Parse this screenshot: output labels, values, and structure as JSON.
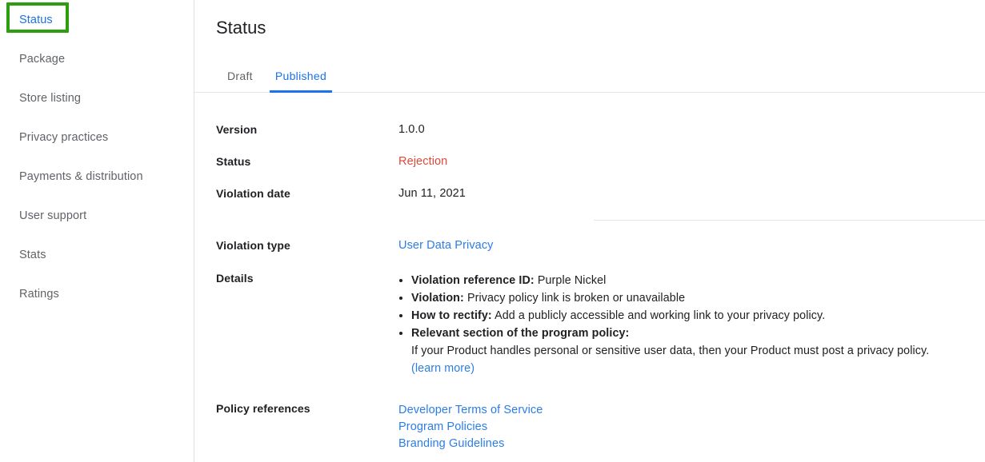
{
  "sidebar": {
    "items": [
      {
        "label": "Status",
        "active": true
      },
      {
        "label": "Package",
        "active": false
      },
      {
        "label": "Store listing",
        "active": false
      },
      {
        "label": "Privacy practices",
        "active": false
      },
      {
        "label": "Payments & distribution",
        "active": false
      },
      {
        "label": "User support",
        "active": false
      },
      {
        "label": "Stats",
        "active": false
      },
      {
        "label": "Ratings",
        "active": false
      }
    ],
    "highlight_color": "#2e9e0e",
    "active_color": "#1a73e8",
    "item_color": "#5f6368"
  },
  "main": {
    "title": "Status",
    "tabs": [
      {
        "label": "Draft",
        "selected": false
      },
      {
        "label": "Published",
        "selected": true
      }
    ],
    "rows": {
      "version": {
        "label": "Version",
        "value": "1.0.0"
      },
      "status": {
        "label": "Status",
        "value": "Rejection",
        "value_color": "#e0483a"
      },
      "violation_date": {
        "label": "Violation date",
        "value": "Jun 11, 2021"
      },
      "violation_type": {
        "label": "Violation type",
        "value": "User Data Privacy",
        "is_link": true
      },
      "details": {
        "label": "Details",
        "bullets": [
          {
            "strong": "Violation reference ID:",
            "text": " Purple Nickel"
          },
          {
            "strong": "Violation:",
            "text": " Privacy policy link is broken or unavailable"
          },
          {
            "strong": "How to rectify:",
            "text": " Add a publicly accessible and working link to your privacy policy."
          },
          {
            "strong": "Relevant section of the program policy:",
            "text": "",
            "sub_text": "If your Product handles personal or sensitive user data, then your Product must post a privacy policy.",
            "sub_link": "(learn more)"
          }
        ]
      },
      "policy_references": {
        "label": "Policy references",
        "links": [
          "Developer Terms of Service",
          "Program Policies",
          "Branding Guidelines"
        ]
      }
    },
    "link_color": "#2b7de9"
  }
}
